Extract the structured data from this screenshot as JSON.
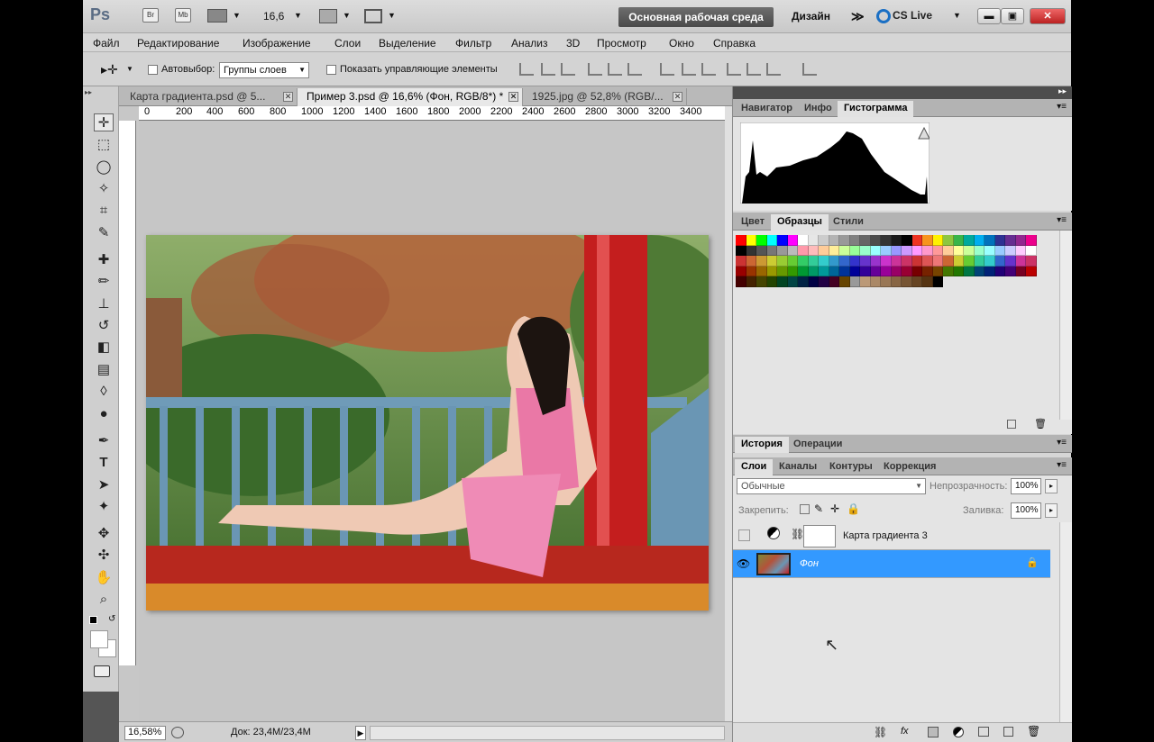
{
  "title_bar": {
    "logo": "Ps",
    "br_label": "Br",
    "mb_label": "Mb",
    "zoom": "16,6",
    "workspace_button": "Основная рабочая среда",
    "design_label": "Дизайн",
    "more_label": "≫",
    "cslive_label": "CS Live"
  },
  "menu": [
    "Файл",
    "Редактирование",
    "Изображение",
    "Слои",
    "Выделение",
    "Фильтр",
    "Анализ",
    "3D",
    "Просмотр",
    "Окно",
    "Справка"
  ],
  "options_bar": {
    "autoselect_label": "Автовыбор:",
    "autoselect_value": "Группы слоев",
    "show_controls_label": "Показать управляющие элементы"
  },
  "document": {
    "tabs": [
      {
        "label": "Карта градиента.psd @ 5..."
      },
      {
        "label": "Пример 3.psd @ 16,6% (Фон, RGB/8*) *"
      },
      {
        "label": "1925.jpg @ 52,8% (RGB/..."
      }
    ],
    "ruler_labels": [
      "0",
      "200",
      "400",
      "600",
      "800",
      "1000",
      "1200",
      "1400",
      "1600",
      "1800",
      "2000",
      "2200",
      "2400",
      "2600",
      "2800",
      "3000",
      "3200",
      "3400"
    ],
    "status_zoom": "16,58%",
    "status_doc": "Док: 23,4M/23,4M"
  },
  "panels": {
    "top_tabs": [
      "Навигатор",
      "Инфо",
      "Гистограмма"
    ],
    "swatch_tabs": [
      "Цвет",
      "Образцы",
      "Стили"
    ],
    "history_tabs": [
      "История",
      "Операции"
    ],
    "layer_tabs": [
      "Слои",
      "Каналы",
      "Контуры",
      "Коррекция"
    ],
    "blend_mode": "Обычные",
    "opacity_label": "Непрозрачность:",
    "opacity_value": "100%",
    "lock_label": "Закрепить:",
    "fill_label": "Заливка:",
    "fill_value": "100%",
    "layers": [
      {
        "name": "Карта градиента 3"
      },
      {
        "name": "Фон"
      }
    ]
  },
  "colors": {
    "selection": "#3399ff",
    "workspace_button": "#555555"
  }
}
